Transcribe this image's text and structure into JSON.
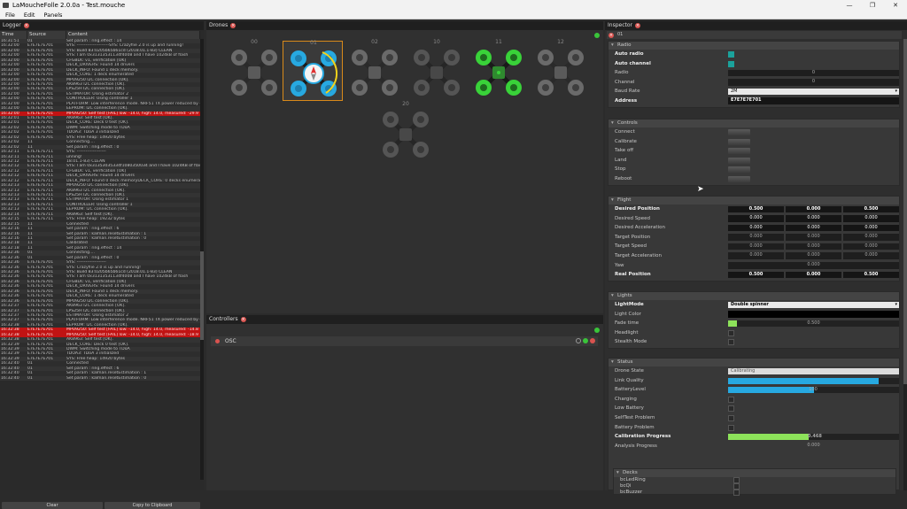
{
  "window": {
    "title": "LaMoucheFolle 2.0.0a - Test.mouche",
    "buttons": [
      "—",
      "❐",
      "✕"
    ]
  },
  "menu": [
    "File",
    "Edit",
    "Panels"
  ],
  "logger": {
    "tab": "Logger",
    "columns": [
      "Time",
      "Source",
      "Content"
    ],
    "rows": [
      [
        "16:31:51",
        "01",
        "Set param : ring.effect : 14",
        false
      ],
      [
        "16:32:00",
        "E7E7E7E701",
        "SYS: ----------------------SYS: Crazyflie 2.0 is up and running!",
        false
      ],
      [
        "16:32:00",
        "E7E7E7E701",
        "SYS: Build 83:0205b65b61cd (2018.01.1-83) CLEAN",
        false
      ],
      [
        "16:32:00",
        "E7E7E7E701",
        "SYS: I am 0x31313531134f4008 and I have 1024kB of flash",
        false
      ],
      [
        "16:32:00",
        "E7E7E7E701",
        "CFGBLK: v1, verification [OK]",
        false
      ],
      [
        "16:32:00",
        "E7E7E7E701",
        "DECK_DRIVERS: Found 14 drivers",
        false
      ],
      [
        "16:32:00",
        "E7E7E7E701",
        "DECK_INFO: Found 1 deck memory.",
        false
      ],
      [
        "16:32:00",
        "E7E7E7E701",
        "DECK_CORE: 1 deck enumerated",
        false
      ],
      [
        "16:32:00",
        "E7E7E7E701",
        "MPU9250 I2C connection [OK].",
        false
      ],
      [
        "16:32:00",
        "E7E7E7E701",
        "AK8963 I2C connection [OK].",
        false
      ],
      [
        "16:32:00",
        "E7E7E7E701",
        "LPS25H I2C connection [OK].",
        false
      ],
      [
        "16:32:00",
        "E7E7E7E701",
        "ESTIMATOR: Using estimator 2",
        false
      ],
      [
        "16:32:00",
        "E7E7E7E701",
        "CONTROLLER: Using controller 1",
        false
      ],
      [
        "16:32:00",
        "E7E7E7E701",
        "PLATFORM: Low interference mode. NRF51 TX power reduced by -12db.",
        false
      ],
      [
        "16:32:00",
        "E7E7E7E701",
        "EEPROM: I2C connection [OK].",
        false
      ],
      [
        "16:32:00",
        "E7E7E7E701",
        "MPU9250: Self test [FAIL] low: -14.0, high: 14.0, measured: -29.9",
        true
      ],
      [
        "16:32:01",
        "E7E7E7E701",
        "AK8963: Self test [OK].",
        false
      ],
      [
        "16:32:01",
        "E7E7E7E701",
        "DECK_CORE: Deck 0 test [OK].",
        false
      ],
      [
        "16:32:02",
        "E7E7E7E701",
        "DWM: Switching mode to TDoA",
        false
      ],
      [
        "16:32:02",
        "E7E7E7E701",
        "TDOA3: TDoA 3 initialized",
        false
      ],
      [
        "16:32:02",
        "E7E7E7E701",
        "SYS: Free heap: 14920 bytes",
        false
      ],
      [
        "16:32:02",
        "11",
        "Connecting....",
        false
      ],
      [
        "16:32:02",
        "11",
        "Set param : ring.effect : 0",
        false
      ],
      [
        "16:32:11",
        "E7E7E7E711",
        "SYS: --------------------",
        false
      ],
      [
        "16:32:11",
        "E7E7E7E711",
        "unning!",
        false
      ],
      [
        "16:32:12",
        "E7E7E7E711",
        "18.01.1-83) CLEAN",
        false
      ],
      [
        "16:32:12",
        "E7E7E7E711",
        "SYS: I am 0x31353035334f1080350034 and I have 1024KB of flash",
        false
      ],
      [
        "16:32:12",
        "E7E7E7E711",
        "CFGBLK: v1, verification [OK]",
        false
      ],
      [
        "16:32:12",
        "E7E7E7E711",
        "DECK_DRIVERS: Found 14 drivers",
        false
      ],
      [
        "16:32:12",
        "E7E7E7E711",
        "DECK_INFO: Found 0 deck memoryDECK_CORE: 0 decks enumerated",
        false
      ],
      [
        "16:32:13",
        "E7E7E7E711",
        "MPU9250 I2C connection [OK].",
        false
      ],
      [
        "16:32:13",
        "E7E7E7E711",
        "AK8963 I2C connection [OK].",
        false
      ],
      [
        "16:32:13",
        "E7E7E7E711",
        "LPS25H I2C connection [OK].",
        false
      ],
      [
        "16:32:13",
        "E7E7E7E711",
        "ESTIMATOR: Using estimator 1",
        false
      ],
      [
        "16:32:13",
        "E7E7E7E711",
        "CONTROLLER: Using controller 1",
        false
      ],
      [
        "16:32:13",
        "E7E7E7E711",
        "EEPROM: I2C connection [OK].",
        false
      ],
      [
        "16:32:14",
        "E7E7E7E711",
        "AK8963: Self test [OK].",
        false
      ],
      [
        "16:32:15",
        "E7E7E7E711",
        "SYS: Free heap: 19232 bytes",
        false
      ],
      [
        "16:32:15",
        "11",
        "Connected",
        false
      ],
      [
        "16:32:16",
        "11",
        "Set param : ring.effect : 6",
        false
      ],
      [
        "16:32:16",
        "11",
        "Set param : kalman.resetEstimation : 1",
        false
      ],
      [
        "16:32:16",
        "11",
        "Set param : kalman.resetEstimation : 0",
        false
      ],
      [
        "16:32:18",
        "11",
        "Calibrated",
        false
      ],
      [
        "16:32:18",
        "11",
        "Set param : ring.effect : 14",
        false
      ],
      [
        "16:32:36",
        "01",
        "Connecting....",
        false
      ],
      [
        "16:32:36",
        "01",
        "Set param : ring.effect : 0",
        false
      ],
      [
        "16:32:36",
        "E7E7E7E701",
        "SYS: --------------------",
        false
      ],
      [
        "16:32:36",
        "E7E7E7E701",
        "SYS: Crazyflie 2.0 is up and running!",
        false
      ],
      [
        "16:32:36",
        "E7E7E7E701",
        "SYS: Build 83:0205b65b61cd (2018.01.1-83) CLEAN",
        false
      ],
      [
        "16:32:36",
        "E7E7E7E701",
        "SYS: I am 0x31313531134f4008 and I have 1024kB of flash",
        false
      ],
      [
        "16:32:36",
        "E7E7E7E701",
        "CFGBLK: v1, verification [OK]",
        false
      ],
      [
        "16:32:36",
        "E7E7E7E701",
        "DECK_DRIVERS: Found 14 drivers",
        false
      ],
      [
        "16:32:36",
        "E7E7E7E701",
        "DECK_INFO: Found 1 deck memory.",
        false
      ],
      [
        "16:32:36",
        "E7E7E7E701",
        "DECK_CORE: 1 deck enumerated",
        false
      ],
      [
        "16:32:36",
        "E7E7E7E701",
        "MPU9250 I2C connection [OK].",
        false
      ],
      [
        "16:32:37",
        "E7E7E7E701",
        "AK8963 I2C connection [OK].",
        false
      ],
      [
        "16:32:37",
        "E7E7E7E701",
        "LPS25H I2C connection [OK].",
        false
      ],
      [
        "16:32:37",
        "E7E7E7E701",
        "ESTIMATOR: Using estimator 2",
        false
      ],
      [
        "16:32:37",
        "E7E7E7E701",
        "PLATFORM: Low interference mode. NRF51 TX power reduced by -12db.",
        false
      ],
      [
        "16:32:38",
        "E7E7E7E701",
        "EEPROM: I2C connection [OK].",
        false
      ],
      [
        "16:32:38",
        "E7E7E7E701",
        "MPU9250: Self test [FAIL] low: -14.0, high: 14.0, measured: -14.8",
        true
      ],
      [
        "16:32:38",
        "E7E7E7E701",
        "MPU9250: Self test [FAIL] low: -14.0, high: 14.0, measured: -18.9",
        true
      ],
      [
        "16:32:38",
        "E7E7E7E701",
        "AK8963: Self test [OK].",
        false
      ],
      [
        "16:32:39",
        "E7E7E7E701",
        "DECK_CORE: Deck 0 test [OK].",
        false
      ],
      [
        "16:32:39",
        "E7E7E7E701",
        "DWM: Switching mode to TDoA",
        false
      ],
      [
        "16:32:39",
        "E7E7E7E701",
        "TDOA3: TDoA 3 initialized",
        false
      ],
      [
        "16:32:39",
        "E7E7E7E701",
        "SYS: Free heap: 14920 bytes",
        false
      ],
      [
        "16:32:40",
        "01",
        "Connected",
        false
      ],
      [
        "16:32:40",
        "01",
        "Set param : ring.effect : 6",
        false
      ],
      [
        "16:32:40",
        "01",
        "Set param : kalman.resetEstimation : 1",
        false
      ],
      [
        "16:32:40",
        "01",
        "Set param : kalman.resetEstimation : 0",
        false
      ]
    ],
    "clear_label": "Clear",
    "copy_label": "Copy to Clipboard"
  },
  "drones": {
    "tab": "Drones",
    "items": [
      {
        "id": "00",
        "state": "idle"
      },
      {
        "id": "01",
        "state": "selected"
      },
      {
        "id": "02",
        "state": "idle"
      },
      {
        "id": "10",
        "state": "dim"
      },
      {
        "id": "11",
        "state": "green"
      },
      {
        "id": "12",
        "state": "idle"
      },
      {
        "id": "20",
        "state": "dim"
      }
    ]
  },
  "controllers": {
    "tab": "Controllers",
    "items": [
      {
        "name": "OSC"
      }
    ]
  },
  "inspector": {
    "tab": "Inspector",
    "subject": "01",
    "radio": {
      "title": "Radio",
      "auto_radio": "Auto radio",
      "auto_channel": "Auto channel",
      "radio_label": "Radio",
      "radio_value": "0",
      "channel_label": "Channel",
      "channel_value": "0",
      "baud_label": "Baud Rate",
      "baud_value": "2M",
      "address_label": "Address",
      "address_value": "E7E7E7E701"
    },
    "controls": {
      "title": "Controls",
      "items": [
        "Connect",
        "Calibrate",
        "Take off",
        "Land",
        "Stop",
        "Reboot"
      ]
    },
    "flight": {
      "title": "Flight",
      "rows": [
        {
          "label": "Desired Position",
          "bold": true,
          "values": [
            "0.500",
            "0.000",
            "0.500"
          ],
          "on": true
        },
        {
          "label": "Desired Speed",
          "bold": false,
          "values": [
            "0.000",
            "0.000",
            "0.000"
          ],
          "on": true
        },
        {
          "label": "Desired Acceleration",
          "bold": false,
          "values": [
            "0.000",
            "0.000",
            "0.000"
          ],
          "on": true
        },
        {
          "label": "Target Position",
          "bold": false,
          "values": [
            "0.000",
            "0.000",
            "0.000"
          ],
          "on": false
        },
        {
          "label": "Target Speed",
          "bold": false,
          "values": [
            "0.000",
            "0.000",
            "0.000"
          ],
          "on": false
        },
        {
          "label": "Target Acceleration",
          "bold": false,
          "values": [
            "0.000",
            "0.000",
            "0.000"
          ],
          "on": false
        },
        {
          "label": "Yaw",
          "bold": false,
          "values": [
            "0.000"
          ],
          "on": false
        },
        {
          "label": "Real Position",
          "bold": true,
          "values": [
            "0.500",
            "0.000",
            "0.500"
          ],
          "on": true
        }
      ]
    },
    "lights": {
      "title": "Lights",
      "mode_label": "LightMode",
      "mode_value": "Double spinner",
      "color_label": "Light Color",
      "fade_label": "Fade time",
      "fade_value": "0.500",
      "fade_fraction": 0.05,
      "headlight_label": "Headlight",
      "stealth_label": "Stealth Mode"
    },
    "status": {
      "title": "Status",
      "state_label": "Drone State",
      "state_value": "Calibrating",
      "link_label": "Link Quality",
      "link_fraction": 0.88,
      "battery_label": "BatteryLevel",
      "battery_value": "100",
      "battery_fraction": 0.5,
      "charging_label": "Charging",
      "low_batt_label": "Low Battery",
      "selftest_label": "SelfTest Problem",
      "batt_problem_label": "Battery Problem",
      "calib_label": "Calibration Progress",
      "calib_value": "0.468",
      "calib_fraction": 0.47,
      "analysis_label": "Analysis Progress",
      "analysis_value": "0.000"
    },
    "decks": {
      "title": "Decks",
      "items": [
        "bcLedRing",
        "bcQi",
        "bcBuzzer"
      ]
    }
  },
  "colors": {
    "accent_blue": "#27a9e1",
    "green": "#39d239",
    "teal": "#1ba29c",
    "error_red": "#c01313",
    "selection": "#d98a1a"
  }
}
